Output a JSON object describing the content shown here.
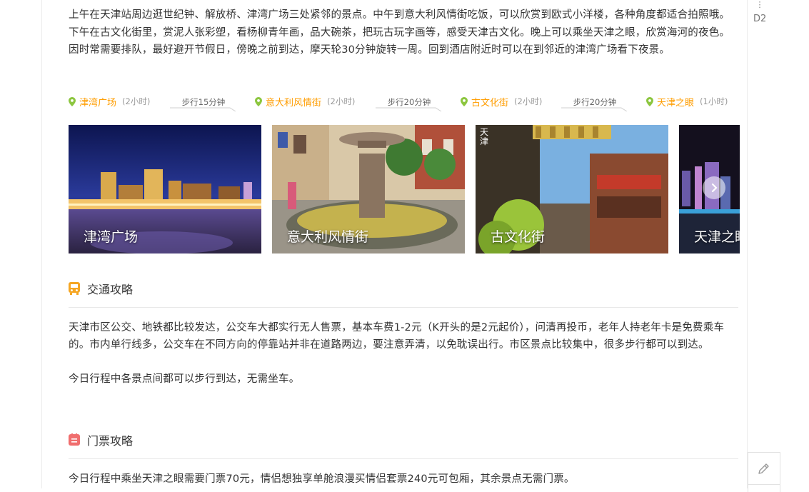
{
  "intro": {
    "text": "上午在天津站周边逛世纪钟、解放桥、津湾广场三处紧邻的景点。中午到意大利风情街吃饭，可以欣赏到欧式小洋楼，各种角度都适合拍照哦。下午在古文化街里，赏泥人张彩塑，看杨柳青年画，品大碗茶，把玩古玩字画等，感受天津古文化。晚上可以乘坐天津之眼，欣赏海河的夜色。因时常需要排队，最好避开节假日，傍晚之前到达，摩天轮30分钟旋转一周。回到酒店附近时可以在到邻近的津湾广场看下夜景。"
  },
  "route": {
    "stops": [
      {
        "name": "津湾广场",
        "duration": "(2小时)"
      },
      {
        "name": "意大利风情街",
        "duration": "(2小时)"
      },
      {
        "name": "古文化街",
        "duration": "(2小时)"
      },
      {
        "name": "天津之眼",
        "duration": "(1小时)"
      }
    ],
    "walks": [
      "步行15分钟",
      "步行20分钟",
      "步行20分钟"
    ]
  },
  "gallery": {
    "photos": [
      {
        "caption": "津湾广场"
      },
      {
        "caption": "意大利风情街"
      },
      {
        "caption": "古文化街"
      },
      {
        "caption": "天津之眼"
      }
    ],
    "photo_mark_text": "天津"
  },
  "traffic": {
    "title": "交通攻略",
    "para1": "天津市区公交、地铁都比较发达，公交车大都实行无人售票，基本车费1-2元（K开头的是2元起价），问清再投币，老年人持老年卡是免费乘车的。市内单行线多，公交车在不同方向的停靠站并非在道路两边，要注意弄清，以免耽误出行。市区景点比较集中，很多步行都可以到达。",
    "para2": "今日行程中各景点间都可以步行到达，无需坐车。"
  },
  "tickets": {
    "title": "门票攻略",
    "para1": "今日行程中乘坐天津之眼需要门票70元，情侣想独享单舱浪漫买情侣套票240元可包厢，其余景点无需门票。"
  },
  "side": {
    "menu_glyph": "⋮",
    "day_tag": "D2"
  },
  "colors": {
    "accent_orange": "#ff9d00",
    "pin_green": "#8cc63f",
    "traffic_icon": "#f5a623",
    "ticket_icon": "#f06e6e"
  }
}
